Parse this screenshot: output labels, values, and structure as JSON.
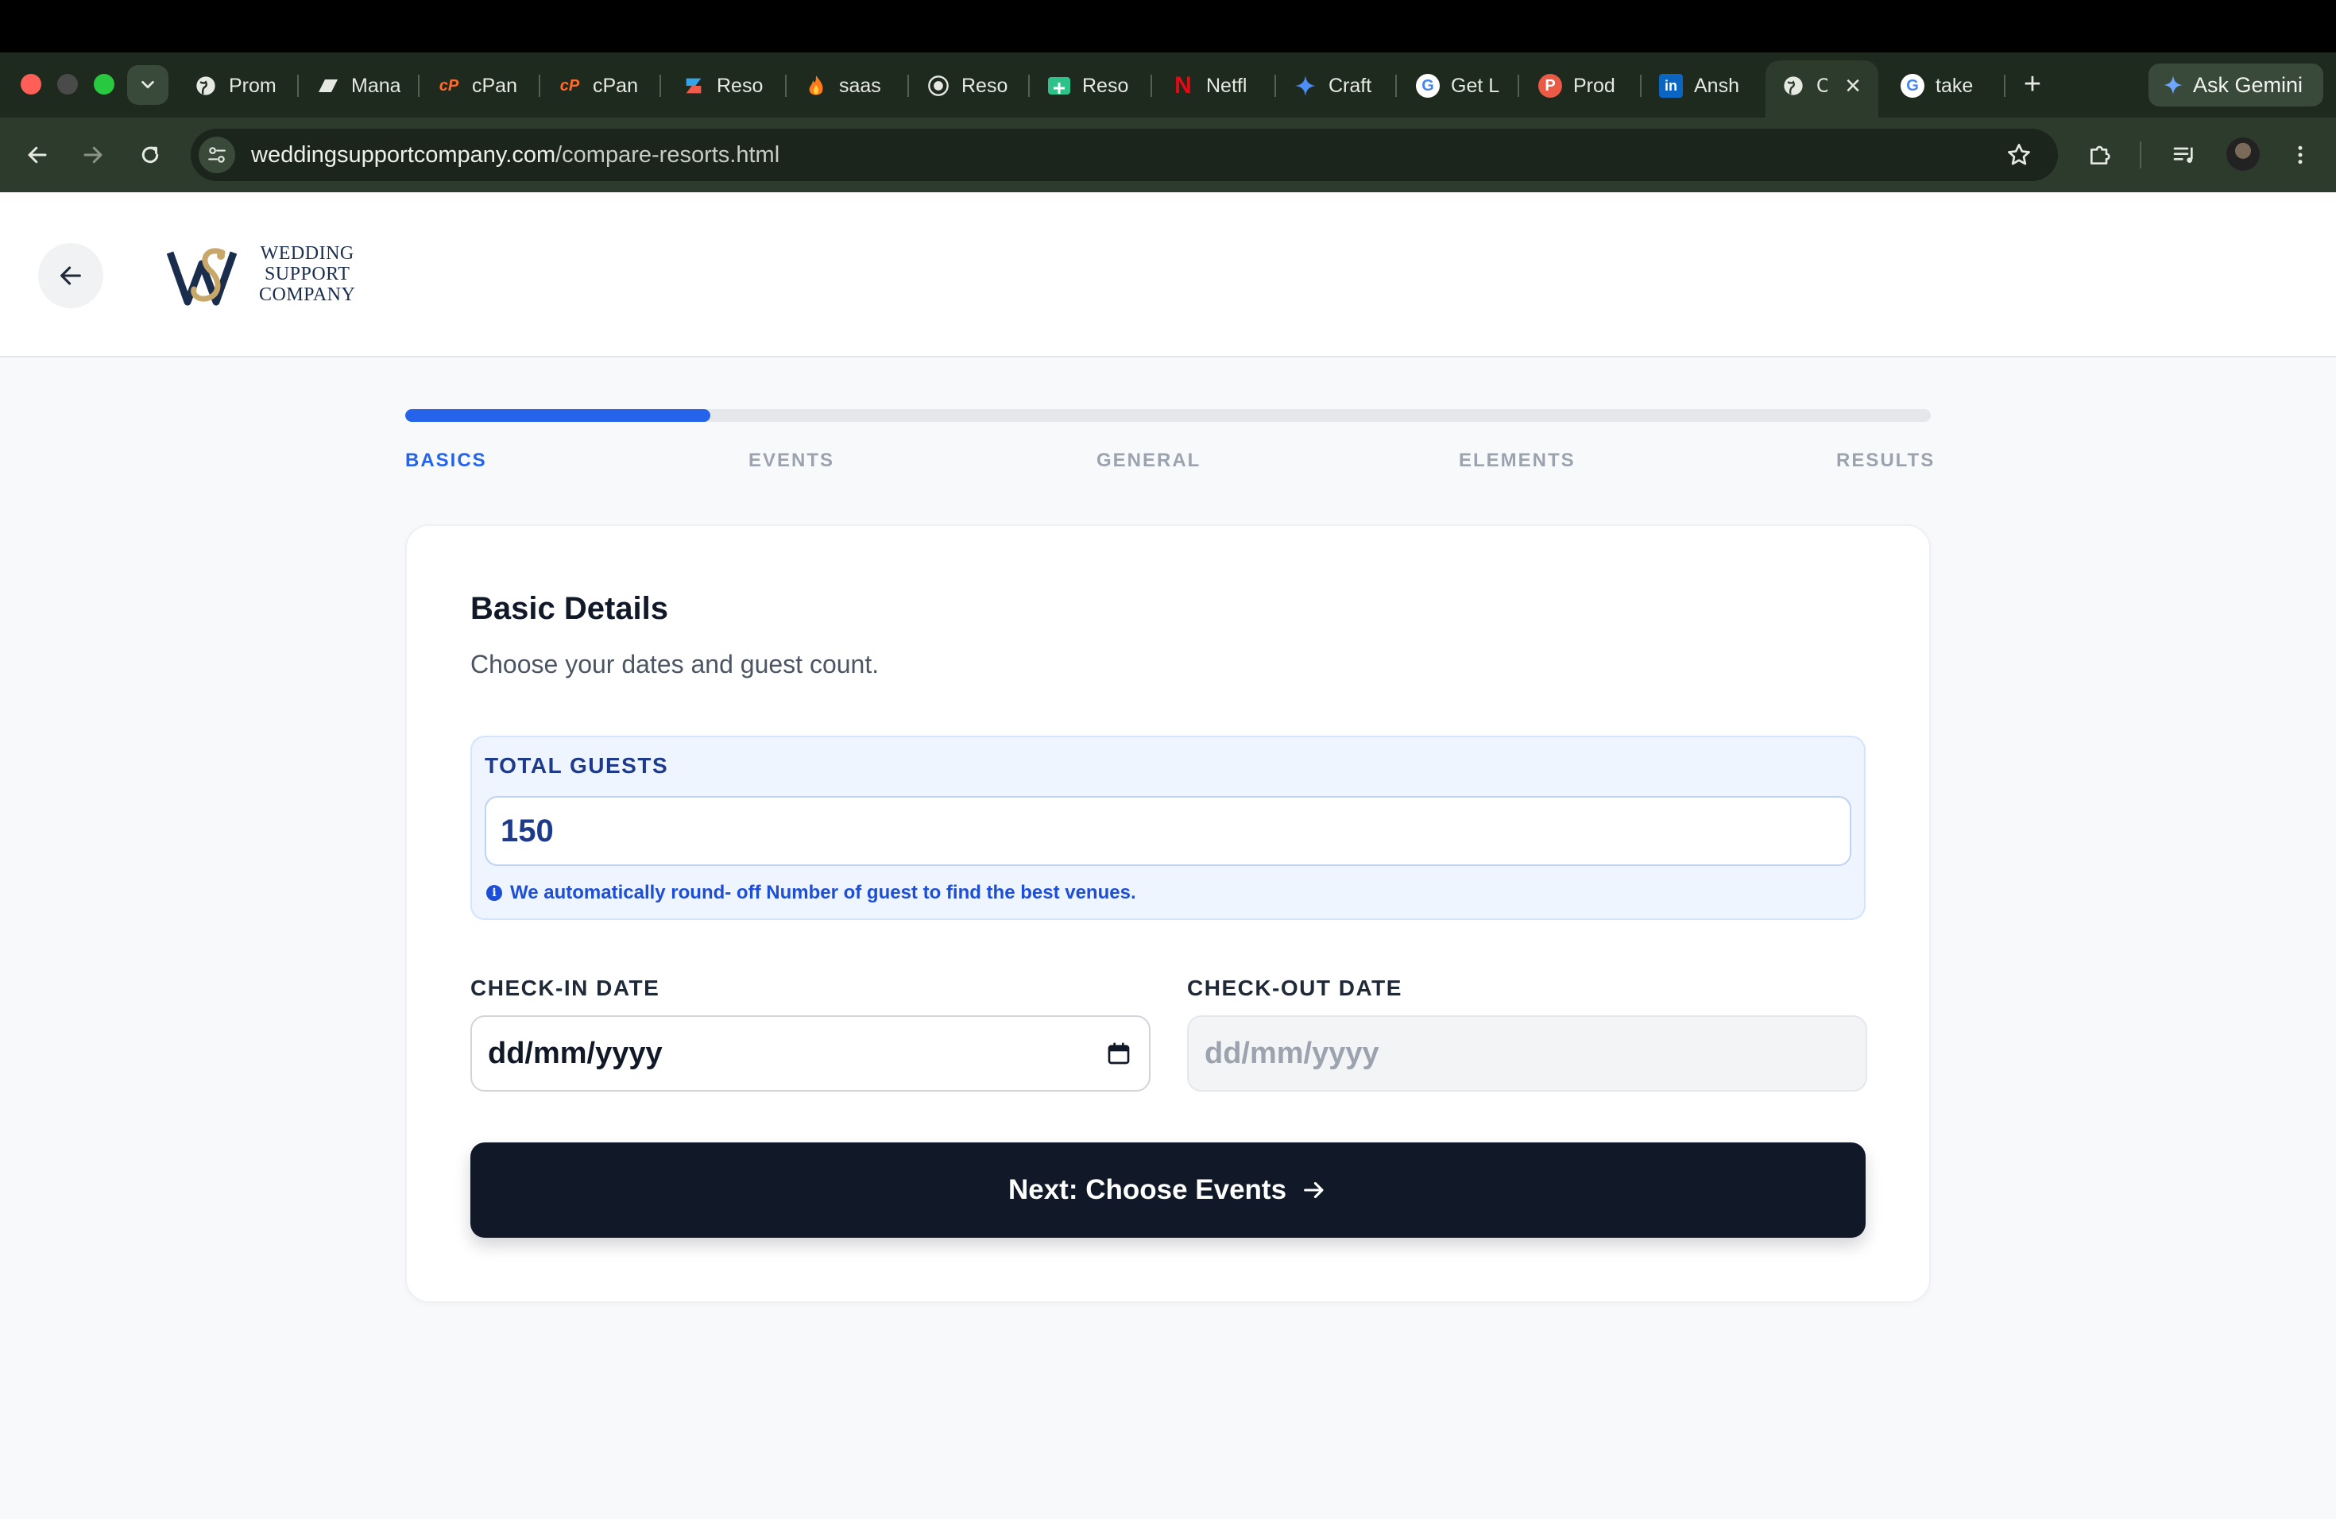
{
  "browser": {
    "tabs": [
      {
        "title": "Prom",
        "icon": "globe-icon"
      },
      {
        "title": "Mana",
        "icon": "manage-icon"
      },
      {
        "title": "cPan",
        "icon": "cpanel-icon"
      },
      {
        "title": "cPan",
        "icon": "cpanel-icon"
      },
      {
        "title": "Reso",
        "icon": "resort-icon"
      },
      {
        "title": "saas",
        "icon": "flame-icon"
      },
      {
        "title": "Reso",
        "icon": "globe-icon"
      },
      {
        "title": "Reso",
        "icon": "resort-green-icon"
      },
      {
        "title": "Netfl",
        "icon": "netflix-icon"
      },
      {
        "title": "Craft",
        "icon": "sparkle-icon"
      },
      {
        "title": "Get L",
        "icon": "google-icon"
      },
      {
        "title": "Prod",
        "icon": "producthunt-icon"
      },
      {
        "title": "Ansh",
        "icon": "linkedin-icon"
      },
      {
        "title": "C",
        "icon": "globe-icon"
      },
      {
        "title": "take",
        "icon": "google-icon"
      }
    ],
    "gemini_label": "Ask Gemini",
    "url_domain": "weddingsupportcompany.com",
    "url_path": "/compare-resorts.html",
    "accent": "#2d3b2c"
  },
  "header": {
    "logo_lines": [
      "WEDDING",
      "SUPPORT",
      "COMPANY"
    ]
  },
  "progress": {
    "fraction": 0.2,
    "steps": [
      "BASICS",
      "EVENTS",
      "GENERAL",
      "ELEMENTS",
      "RESULTS"
    ],
    "active_index": 0,
    "color": "#2563eb"
  },
  "form": {
    "title": "Basic Details",
    "subtitle": "Choose your dates and guest count.",
    "guests_label": "TOTAL GUESTS",
    "guests_value": "150",
    "guests_note": "We automatically round- off Number of guest to find the best venues.",
    "checkin_label": "CHECK-IN DATE",
    "checkin_placeholder": "dd/mm/yyyy",
    "checkout_label": "CHECK-OUT DATE",
    "checkout_placeholder": "dd/mm/yyyy",
    "next_label": "Next: Choose Events"
  }
}
